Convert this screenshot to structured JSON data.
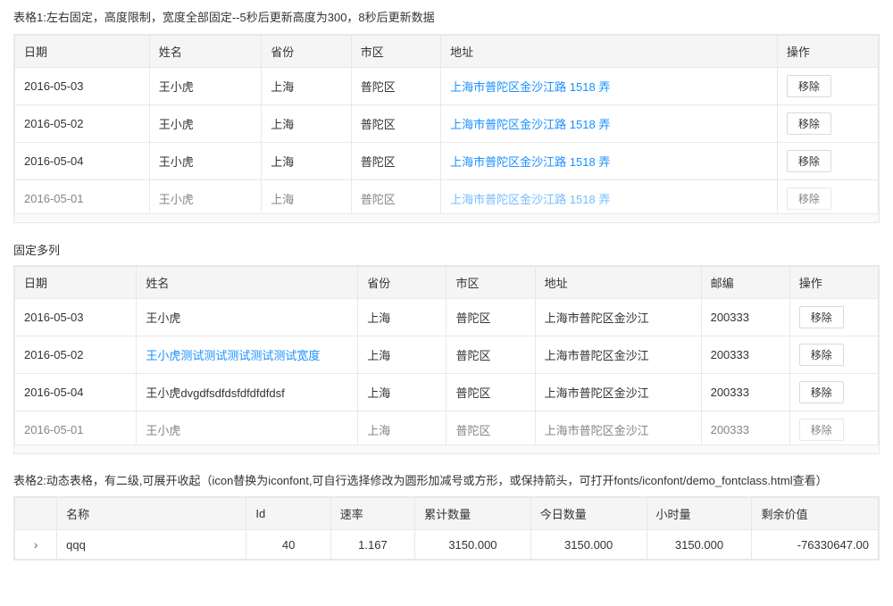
{
  "table1": {
    "title": "表格1:左右固定，高度限制，宽度全部固定--5秒后更新高度为300，8秒后更新数据",
    "columns": [
      "日期",
      "姓名",
      "省份",
      "市区",
      "地址",
      "操作"
    ],
    "rows": [
      {
        "date": "2016-05-03",
        "name": "王小虎",
        "province": "上海",
        "city": "普陀区",
        "address": "上海市普陀区金沙江路 1518 弄",
        "action": "移除"
      },
      {
        "date": "2016-05-02",
        "name": "王小虎",
        "province": "上海",
        "city": "普陀区",
        "address": "上海市普陀区金沙江路 1518 弄",
        "action": "移除"
      },
      {
        "date": "2016-05-04",
        "name": "王小虎",
        "province": "上海",
        "city": "普陀区",
        "address": "上海市普陀区金沙江路 1518 弄",
        "action": "移除"
      },
      {
        "date": "2016-05-01",
        "name": "王小虎",
        "province": "上海",
        "city": "普陀区",
        "address": "上海市普陀区金沙江路 1518 弄",
        "action": "移除"
      }
    ],
    "remove_label": "移除"
  },
  "table2": {
    "title": "固定多列",
    "columns": [
      "日期",
      "姓名",
      "省份",
      "市区",
      "地址",
      "邮编",
      "操作"
    ],
    "rows": [
      {
        "date": "2016-05-03",
        "name": "王小虎",
        "province": "上海",
        "city": "普陀区",
        "address": "上海市普陀区金沙江",
        "zip": "200333",
        "action": "移除"
      },
      {
        "date": "2016-05-02",
        "name": "王小虎测试测试测试测试测试宽度",
        "province": "上海",
        "city": "普陀区",
        "address": "上海市普陀区金沙江",
        "zip": "200333",
        "action": "移除"
      },
      {
        "date": "2016-05-04",
        "name": "王小虎dvgdfsdfdsfdfdfdfdsf",
        "province": "上海",
        "city": "普陀区",
        "address": "上海市普陀区金沙江",
        "zip": "200333",
        "action": "移除"
      },
      {
        "date": "2016-05-01",
        "name": "王小虎",
        "province": "上海",
        "city": "普陀区",
        "address": "上海市普陀区金沙江",
        "zip": "200333",
        "action": "移除"
      }
    ]
  },
  "table3": {
    "title": "表格2:动态表格，有二级,可展开收起（icon替换为iconfont,可自行选择修改为圆形加减号或方形，或保持箭头，可打开fonts/iconfont/demo_fontclass.html查看）",
    "columns": [
      "名称",
      "Id",
      "速率",
      "累计数量",
      "今日数量",
      "小时量",
      "剩余价值"
    ],
    "rows": [
      {
        "expand": ">",
        "name": "qqq",
        "id": "40",
        "rate": "1.167",
        "total": "3150.000",
        "today": "3150.000",
        "hours": "3150.000",
        "remain": "-76330647.00"
      }
    ]
  },
  "icons": {
    "expand_right": "›",
    "scrollbar": "▐"
  }
}
